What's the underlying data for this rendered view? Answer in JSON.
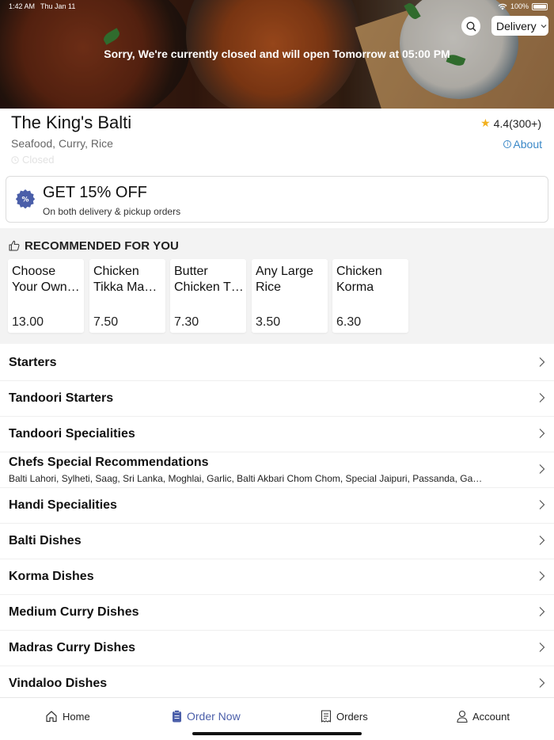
{
  "status_bar": {
    "time": "1:42 AM",
    "date": "Thu Jan 11",
    "battery": "100%"
  },
  "hero": {
    "closed_message": "Sorry, We're currently closed and will open Tomorrow at 05:00 PM",
    "order_mode": "Delivery"
  },
  "restaurant": {
    "name": "The King's Balti",
    "tags": "Seafood, Curry, Rice",
    "status": "Closed",
    "rating": "4.4(300+)",
    "about_label": "About"
  },
  "offer": {
    "title": "GET 15% OFF",
    "subtitle": "On both delivery & pickup orders"
  },
  "recommended": {
    "title": "RECOMMENDED FOR YOU",
    "items": [
      {
        "line1": "Choose",
        "line2": "Your Own…",
        "price": "13.00"
      },
      {
        "line1": "Chicken",
        "line2": "Tikka Ma…",
        "price": "7.50"
      },
      {
        "line1": "Butter",
        "line2": "Chicken T…",
        "price": "7.30"
      },
      {
        "line1": "Any Large",
        "line2": "Rice",
        "price": "3.50"
      },
      {
        "line1": "Chicken",
        "line2": "Korma",
        "price": "6.30"
      }
    ]
  },
  "menu": [
    {
      "label": "Starters"
    },
    {
      "label": "Tandoori Starters"
    },
    {
      "label": "Tandoori Specialities"
    },
    {
      "label": "Chefs Special Recommendations",
      "desc": "Balti Lahori, Sylheti, Saag, Sri Lanka, Moghlai, Garlic, Balti Akbari Chom Chom, Special Jaipuri, Passanda, Ga…"
    },
    {
      "label": "Handi Specialities"
    },
    {
      "label": "Balti Dishes"
    },
    {
      "label": "Korma Dishes"
    },
    {
      "label": "Medium Curry Dishes"
    },
    {
      "label": "Madras Curry Dishes"
    },
    {
      "label": "Vindaloo Dishes"
    }
  ],
  "nav": {
    "home": "Home",
    "order_now": "Order Now",
    "orders": "Orders",
    "account": "Account"
  },
  "colors": {
    "accent": "#4a5ea9",
    "link": "#3a88c7",
    "star": "#f2b01e"
  }
}
